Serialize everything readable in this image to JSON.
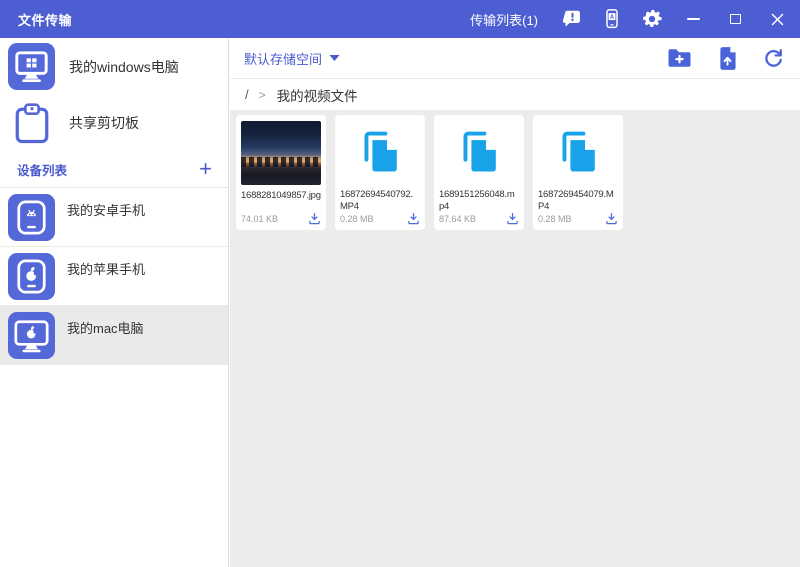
{
  "titlebar": {
    "app_title": "文件传输",
    "transfer_list_label": "传输列表(1)",
    "phone_icon_letter": "A"
  },
  "sidebar": {
    "computer_label": "我的windows电脑",
    "clipboard_label": "共享剪切板",
    "device_list_title": "设备列表",
    "add_device_label": "+",
    "devices": [
      {
        "label": "我的安卓手机",
        "type": "android-phone",
        "selected": false
      },
      {
        "label": "我的苹果手机",
        "type": "apple-phone",
        "selected": false
      },
      {
        "label": "我的mac电脑",
        "type": "mac-computer",
        "selected": true
      }
    ]
  },
  "main": {
    "storage_dropdown_label": "默认存储空间",
    "breadcrumb": {
      "root": "/",
      "separator": ">",
      "current_folder": "我的视频文件"
    },
    "files": [
      {
        "name": "1688281049857.jpg",
        "size": "74.01 KB",
        "kind": "image"
      },
      {
        "name": "16872694540792.MP4",
        "size": "0.28 MB",
        "kind": "video"
      },
      {
        "name": "1689151256048.mp4",
        "size": "87.64 KB",
        "kind": "video"
      },
      {
        "name": "1687269454079.MP4",
        "size": "0.28 MB",
        "kind": "video"
      }
    ]
  },
  "colors": {
    "titlebar_bg": "#4d5ed2",
    "accent_text": "#4a5bd0",
    "device_icon_bg": "#5468d8",
    "file_icon": "#18a2ea",
    "download_icon": "#4a6bd8",
    "content_bg": "#edecec",
    "selected_row_bg": "#eaeaea"
  }
}
